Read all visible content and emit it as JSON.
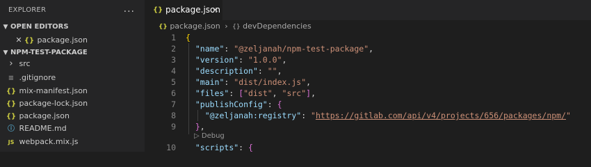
{
  "sidebar": {
    "title": "EXPLORER",
    "more_icon": "...",
    "open_editors": {
      "label": "OPEN EDITORS",
      "items": [
        {
          "close": "✕",
          "icon": "{}",
          "label": "package.json"
        }
      ]
    },
    "project": {
      "label": "NPM-TEST-PACKAGE",
      "items": [
        {
          "icon": "›",
          "label": "src",
          "type": "folder"
        },
        {
          "icon": "≡",
          "label": ".gitignore",
          "type": "git"
        },
        {
          "icon": "{}",
          "label": "mix-manifest.json",
          "type": "json"
        },
        {
          "icon": "{}",
          "label": "package-lock.json",
          "type": "json"
        },
        {
          "icon": "{}",
          "label": "package.json",
          "type": "json"
        },
        {
          "icon": "ⓘ",
          "label": "README.md",
          "type": "info"
        },
        {
          "icon": "JS",
          "label": "webpack.mix.js",
          "type": "js"
        }
      ]
    }
  },
  "tab": {
    "icon": "{}",
    "label": "package.json",
    "close": "✕"
  },
  "breadcrumb": {
    "file_icon": "{}",
    "file": "package.json",
    "separator": "›",
    "symbol_icon": "{}",
    "symbol": "devDependencies"
  },
  "line_numbers": [
    "1",
    "2",
    "3",
    "4",
    "5",
    "6",
    "7",
    "8",
    "9",
    "10"
  ],
  "code": {
    "l1_open": "{",
    "name_key": "\"name\"",
    "name_val": "\"@zeljanah/npm-test-package\"",
    "version_key": "\"version\"",
    "version_val": "\"1.0.0\"",
    "description_key": "\"description\"",
    "description_val": "\"\"",
    "main_key": "\"main\"",
    "main_val": "\"dist/index.js\"",
    "files_key": "\"files\"",
    "files_val1": "\"dist\"",
    "files_val2": "\"src\"",
    "publish_key": "\"publishConfig\"",
    "registry_key": "\"@zeljanah:registry\"",
    "registry_val_q1": "\"",
    "registry_url": "https://gitlab.com/api/v4/projects/656/packages/npm/",
    "registry_val_q2": "\"",
    "close_obj": "}",
    "scripts_key": "\"scripts\""
  },
  "codelens": {
    "icon": "▷",
    "label": "Debug"
  }
}
